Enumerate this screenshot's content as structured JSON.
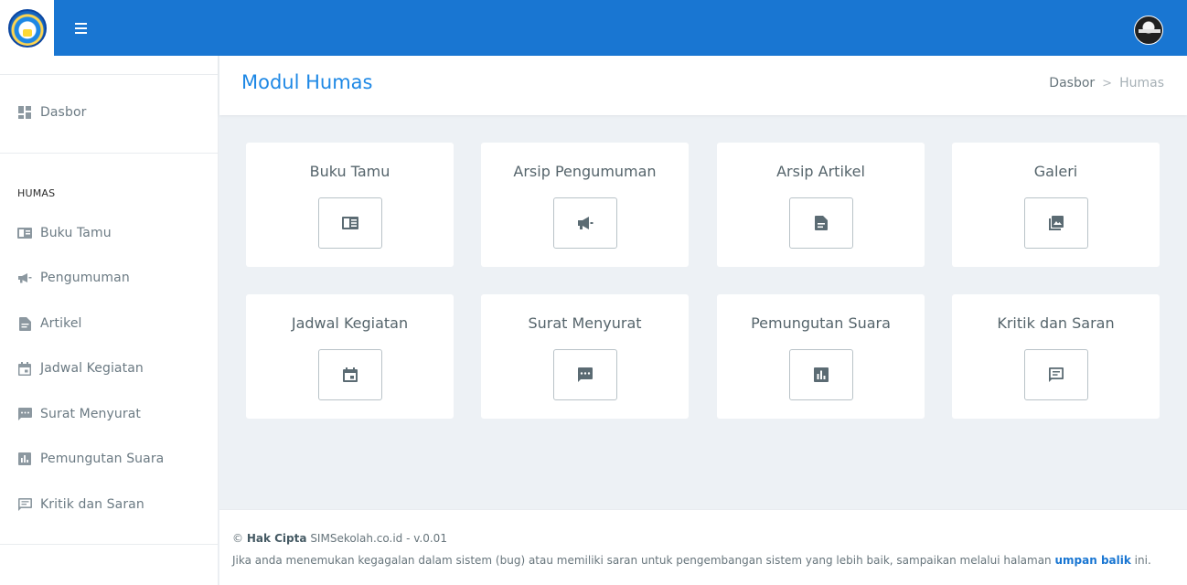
{
  "app": {
    "logo_label": "SMANDA",
    "accent_color": "#1976d2"
  },
  "topbar": {
    "menu_icon": "hamburger-icon",
    "avatar_icon": "user-avatar"
  },
  "sidebar": {
    "dashboard": {
      "label": "Dasbor",
      "icon": "dashboard-icon"
    },
    "section_heading": "HUMAS",
    "items": [
      {
        "label": "Buku Tamu",
        "icon": "book-icon"
      },
      {
        "label": "Pengumuman",
        "icon": "megaphone-icon"
      },
      {
        "label": "Artikel",
        "icon": "article-icon"
      },
      {
        "label": "Jadwal Kegiatan",
        "icon": "calendar-icon"
      },
      {
        "label": "Surat Menyurat",
        "icon": "message-icon"
      },
      {
        "label": "Pemungutan Suara",
        "icon": "poll-icon"
      },
      {
        "label": "Kritik dan Saran",
        "icon": "feedback-icon"
      }
    ]
  },
  "header": {
    "title": "Modul Humas",
    "breadcrumb": {
      "home": "Dasbor",
      "separator": ">",
      "current": "Humas"
    }
  },
  "cards": [
    {
      "title": "Buku Tamu",
      "icon": "book-icon"
    },
    {
      "title": "Arsip Pengumuman",
      "icon": "megaphone-icon"
    },
    {
      "title": "Arsip Artikel",
      "icon": "article-icon"
    },
    {
      "title": "Galeri",
      "icon": "gallery-icon"
    },
    {
      "title": "Jadwal Kegiatan",
      "icon": "calendar-icon"
    },
    {
      "title": "Surat Menyurat",
      "icon": "message-icon"
    },
    {
      "title": "Pemungutan Suara",
      "icon": "poll-icon"
    },
    {
      "title": "Kritik dan Saran",
      "icon": "feedback-icon"
    }
  ],
  "footer": {
    "copyright_symbol": "©",
    "copyright_label": "Hak Cipta",
    "copyright_text": "SIMSekolah.co.id - v.0.01",
    "notice_text": "Jika anda menemukan kegagalan dalam sistem (bug) atau memiliki saran untuk pengembangan sistem yang lebih baik, sampaikan melalui halaman",
    "link_text": "umpan balik",
    "notice_suffix": "ini."
  }
}
